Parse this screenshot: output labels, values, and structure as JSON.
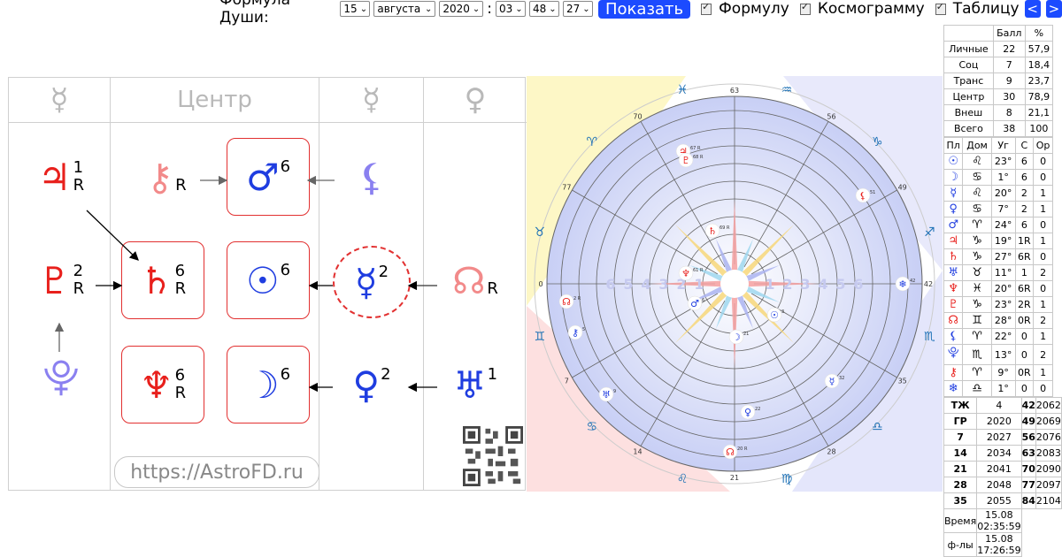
{
  "controls": {
    "label": "Формула Души:",
    "day": "15",
    "month": "августа",
    "year": "2020",
    "colon": ":",
    "hour": "03",
    "minute": "48",
    "second": "27",
    "show": "Показать",
    "opt_formula": "Формулу",
    "opt_cosmogram": "Космограмму",
    "opt_table": "Таблицу",
    "prev": "<",
    "next": ">"
  },
  "formula": {
    "headers": [
      "☿",
      "Центр",
      "☿",
      "♀"
    ],
    "site": "https://AstroFD.ru",
    "cells": [
      {
        "glyph": "♃",
        "num": "1",
        "r": "R",
        "color": "#e8201c"
      },
      {
        "glyph": "⚷",
        "num": "",
        "r": "R",
        "color": "#f28a8a"
      },
      {
        "glyph": "♂",
        "num": "6",
        "r": "",
        "color": "#1f3de0"
      },
      {
        "glyph": "⚸",
        "num": "",
        "r": "",
        "color": "#8a80f0"
      },
      {
        "glyph": "♇",
        "num": "2",
        "r": "R",
        "color": "#e8201c"
      },
      {
        "glyph": "♄",
        "num": "6",
        "r": "R",
        "color": "#e8201c"
      },
      {
        "glyph": "☉",
        "num": "6",
        "r": "",
        "color": "#1f3de0"
      },
      {
        "glyph": "☿",
        "num": "2",
        "r": "",
        "color": "#1f3de0"
      },
      {
        "glyph": "☊",
        "num": "",
        "r": "R",
        "color": "#f28a8a"
      },
      {
        "glyph": "⯓",
        "num": "",
        "r": "",
        "color": "#8a80f0"
      },
      {
        "glyph": "♆",
        "num": "6",
        "r": "R",
        "color": "#e8201c"
      },
      {
        "glyph": "☽",
        "num": "6",
        "r": "",
        "color": "#1f3de0"
      },
      {
        "glyph": "♀",
        "num": "2",
        "r": "",
        "color": "#1f3de0"
      },
      {
        "glyph": "♅",
        "num": "1",
        "r": "",
        "color": "#1f3de0"
      }
    ]
  },
  "chart": {
    "degree_labels": [
      "63",
      "56",
      "49",
      "42",
      "35",
      "28",
      "21",
      "14",
      "7",
      "0",
      "77",
      "70"
    ],
    "signs": [
      "♒",
      "♑",
      "♐",
      "♏",
      "♎",
      "♍",
      "♌",
      "♋",
      "♊",
      "♉",
      "♈",
      "♓"
    ],
    "inner_numbers": [
      "1",
      "2",
      "3",
      "4",
      "5",
      "6"
    ],
    "planets": [
      {
        "g": "♃",
        "t": "67 R"
      },
      {
        "g": "♇",
        "t": "68 R"
      },
      {
        "g": "⚸",
        "t": "51"
      },
      {
        "g": "♄",
        "t": "69 R"
      },
      {
        "g": "♆",
        "t": "61 R"
      },
      {
        "g": "♂",
        "t": "6"
      },
      {
        "g": "☉",
        "t": "3"
      },
      {
        "g": "☽",
        "t": "21"
      },
      {
        "g": "☊",
        "t": "2 R"
      },
      {
        "g": "⚷",
        "t": "5"
      },
      {
        "g": "♅",
        "t": "9"
      },
      {
        "g": "♀",
        "t": "22"
      },
      {
        "g": "☊",
        "t": "20 R"
      },
      {
        "g": "☿",
        "t": "32"
      },
      {
        "g": "❄",
        "t": "42"
      }
    ]
  },
  "table": {
    "head": [
      "Балл",
      "%"
    ],
    "score_rows": [
      {
        "label": "Личные",
        "ball": "22",
        "pct": "57,9"
      },
      {
        "label": "Соц",
        "ball": "7",
        "pct": "18,4"
      },
      {
        "label": "Транс",
        "ball": "9",
        "pct": "23,7"
      },
      {
        "label": "Центр",
        "ball": "30",
        "pct": "78,9"
      },
      {
        "label": "Внеш",
        "ball": "8",
        "pct": "21,1"
      },
      {
        "label": "Всего",
        "ball": "38",
        "pct": "100"
      }
    ],
    "planet_head": [
      "Пл",
      "Дом",
      "Уг",
      "С",
      "Ор"
    ],
    "planet_rows": [
      {
        "pl": "☉",
        "color": "#1f3de0",
        "dom": "♌",
        "ug": "23°",
        "c": "6",
        "or": "0"
      },
      {
        "pl": "☽",
        "color": "#1f3de0",
        "dom": "♋",
        "ug": "1°",
        "c": "6",
        "or": "0"
      },
      {
        "pl": "☿",
        "color": "#1f3de0",
        "dom": "♌",
        "ug": "20°",
        "c": "2",
        "or": "1"
      },
      {
        "pl": "♀",
        "color": "#1f3de0",
        "dom": "♋",
        "ug": "7°",
        "c": "2",
        "or": "1"
      },
      {
        "pl": "♂",
        "color": "#1f3de0",
        "dom": "♈",
        "ug": "24°",
        "c": "6",
        "or": "0"
      },
      {
        "pl": "♃",
        "color": "#e8201c",
        "dom": "♑",
        "ug": "19°",
        "c": "1R",
        "or": "1"
      },
      {
        "pl": "♄",
        "color": "#e8201c",
        "dom": "♑",
        "ug": "27°",
        "c": "6R",
        "or": "0"
      },
      {
        "pl": "♅",
        "color": "#1f3de0",
        "dom": "♉",
        "ug": "11°",
        "c": "1",
        "or": "2"
      },
      {
        "pl": "♆",
        "color": "#e8201c",
        "dom": "♓",
        "ug": "20°",
        "c": "6R",
        "or": "0"
      },
      {
        "pl": "♇",
        "color": "#e8201c",
        "dom": "♑",
        "ug": "23°",
        "c": "2R",
        "or": "1"
      },
      {
        "pl": "☊",
        "color": "#e8201c",
        "dom": "♊",
        "ug": "28°",
        "c": "0R",
        "or": "2"
      },
      {
        "pl": "⚸",
        "color": "#1f3de0",
        "dom": "♈",
        "ug": "22°",
        "c": "0",
        "or": "1"
      },
      {
        "pl": "⯓",
        "color": "#1f3de0",
        "dom": "♏",
        "ug": "13°",
        "c": "0",
        "or": "2"
      },
      {
        "pl": "⚷",
        "color": "#e8201c",
        "dom": "♈",
        "ug": "9°",
        "c": "0R",
        "or": "1"
      },
      {
        "pl": "❄",
        "color": "#1f3de0",
        "dom": "♎",
        "ug": "1°",
        "c": "0",
        "or": "0"
      }
    ],
    "years": [
      [
        "ТЖ",
        "4",
        "42",
        "2062"
      ],
      [
        "ГР",
        "2020",
        "49",
        "2069"
      ],
      [
        "7",
        "2027",
        "56",
        "2076"
      ],
      [
        "14",
        "2034",
        "63",
        "2083"
      ],
      [
        "21",
        "2041",
        "70",
        "2090"
      ],
      [
        "28",
        "2048",
        "77",
        "2097"
      ],
      [
        "35",
        "2055",
        "84",
        "2104"
      ]
    ],
    "time_label": "Время",
    "time_value": "15.08 02:35:59",
    "f_label": "ф-лы",
    "f_value": "15.08 17:26:59"
  }
}
